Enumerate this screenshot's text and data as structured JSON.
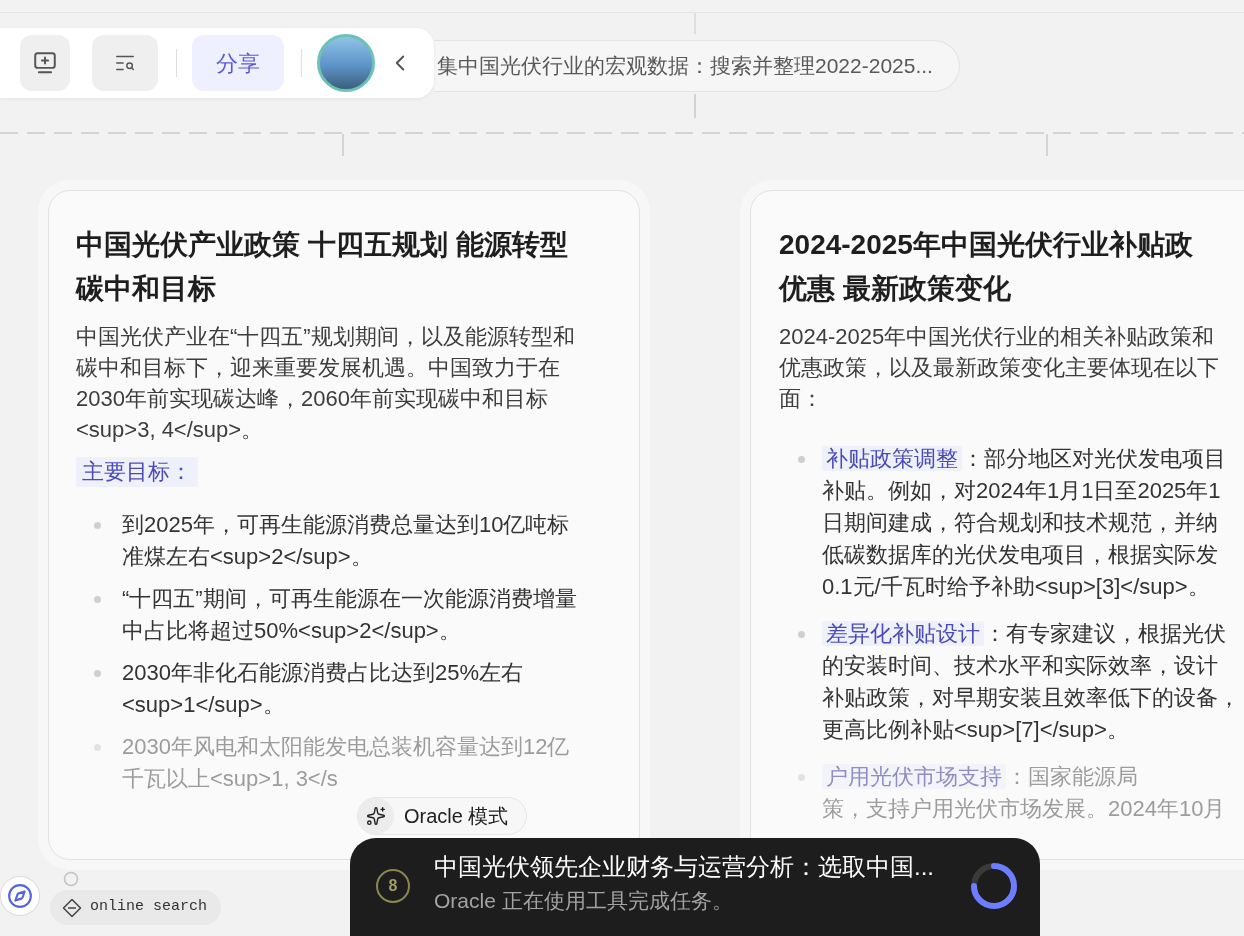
{
  "toolbar": {
    "share_button": "分享"
  },
  "breadcrumb": "集中国光伏行业的宏观数据：搜索并整理2022-2025...",
  "policy_card": {
    "title": "中国光伏产业政策 十四五规划 能源转型碳中和目标",
    "intro": "中国光伏产业在“十四五”规划期间，以及能源转型和碳中和目标下，迎来重要发展机遇。中国致力于在2030年前实现碳达峰，2060年前实现碳中和目标<sup>3, 4</sup>。",
    "section_label": "主要目标：",
    "bullets": [
      {
        "text": "到2025年，可再生能源消费总量达到10亿吨标准煤左右<sup>2</sup>。",
        "faded": false
      },
      {
        "text": "“十四五”期间，可再生能源在一次能源消费增量中占比将超过50%<sup>2</sup>。",
        "faded": false
      },
      {
        "text": "2030年非化石能源消费占比达到25%左右<sup>1</sup>。",
        "faded": false
      },
      {
        "text": "2030年风电和太阳能发电总装机容量达到12亿千瓦以上<sup>1, 3</s",
        "faded": true
      }
    ]
  },
  "subsidy_card": {
    "title_lines": [
      "2024-2025年中国光伏行业补贴政",
      "优惠 最新政策变化"
    ],
    "intro_lines": [
      "2024-2025年中国光伏行业的相关补贴政策和",
      "优惠政策，以及最新政策变化主要体现在以下",
      "面："
    ],
    "bullets": [
      {
        "label": "补贴政策调整",
        "lines": [
          "：部分地区对光伏发电项目",
          "补贴。例如，对2024年1月1日至2025年1",
          "日期间建成，符合规划和技术规范，并纳",
          "低碳数据库的光伏发电项目，根据实际发",
          "0.1元/千瓦时给予补助<sup>[3]</sup>。"
        ],
        "faded": false
      },
      {
        "label": "差异化补贴设计",
        "lines": [
          "：有专家建议，根据光伏",
          "的安装时间、技术水平和实际效率，设计",
          "补贴政策，对早期安装且效率低下的设备，",
          "更高比例补贴<sup>[7]</sup>。"
        ],
        "faded": false
      },
      {
        "label": "户用光伏市场支持",
        "lines": [
          "：国家能源局",
          "策，支持户用光伏市场发展。2024年10月"
        ],
        "faded": true
      }
    ]
  },
  "oracle_mode_chip": "Oracle 模式",
  "online_search_tag": "online search",
  "task_toast": {
    "step": "8",
    "title": "中国光伏领先企业财务与运营分析：选取中国...",
    "status": "Oracle 正在使用工具完成任务。"
  }
}
